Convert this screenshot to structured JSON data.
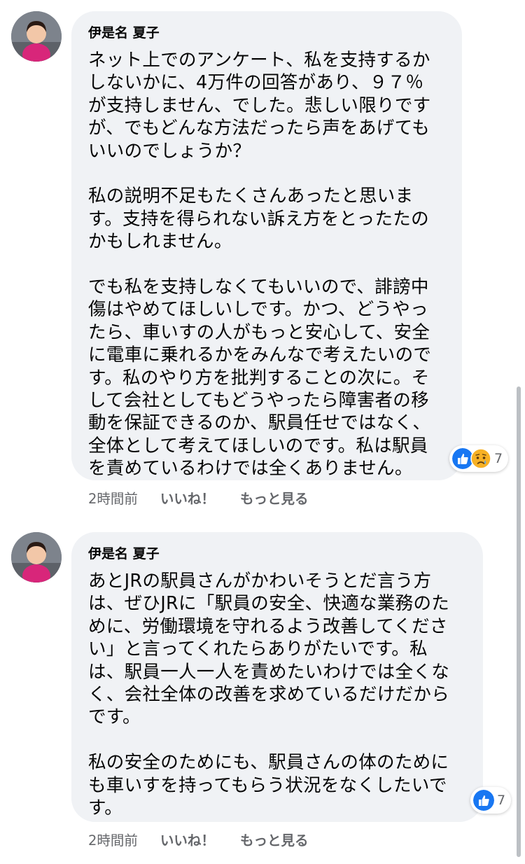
{
  "comments": [
    {
      "author": "伊是名 夏子",
      "paragraphs": [
        [
          "ネット上でのアンケート、私を支持するか",
          "しないかに、4万件の回答があり、９７％",
          "が支持しません、でした。悲しい限りです",
          "が、でもどんな方法だったら声をあげても",
          "いいのでしょうか？"
        ],
        [
          "私の説明不足もたくさんあったと思いま",
          "す。支持を得られない訴え方をとったたの",
          "かもしれません。"
        ],
        [
          "でも私を支持しなくてもいいので、誹謗中",
          "傷はやめてほしいしです。かつ、どうやっ",
          "たら、車いすの人がもっと安心して、安全",
          "に電車に乗れるかをみんなで考えたいので",
          "す。私のやり方を批判することの次に。そ",
          "して会社としてもどうやったら障害者の移",
          "動を保証できるのか、駅員任せではなく、",
          "全体として考えてほしいのです。私は駅員",
          "を責めているわけでは全くありません。"
        ]
      ],
      "reactions": {
        "icons": [
          "like-icon",
          "sad-icon"
        ],
        "count": "7"
      },
      "time": "2時間前",
      "like_label": "いいね！",
      "more_label": "もっと見る"
    },
    {
      "author": "伊是名 夏子",
      "paragraphs": [
        [
          "あとJRの駅員さんがかわいそうとだ言う方",
          "は、ぜひJRに「駅員の安全、快適な業務のた",
          "めに、労働環境を守れるよう改善してくださ",
          "い」と言ってくれたらありがたいです。私",
          "は、駅員一人一人を責めたいわけでは全くな",
          "く、会社全体の改善を求めているだけだから",
          "です。"
        ],
        [
          "私の安全のためにも、駅員さんの体のために",
          "も車いすを持ってもらう状況をなくしたいで",
          "す。"
        ]
      ],
      "reactions": {
        "icons": [
          "like-icon"
        ],
        "count": "7"
      },
      "time": "2時間前",
      "like_label": "いいね！",
      "more_label": "もっと見る"
    }
  ],
  "colors": {
    "bubble": "#f0f2f5",
    "meta_text": "#65676b",
    "like_blue": "#1877f2",
    "sad_yellow": "#f7b125"
  }
}
